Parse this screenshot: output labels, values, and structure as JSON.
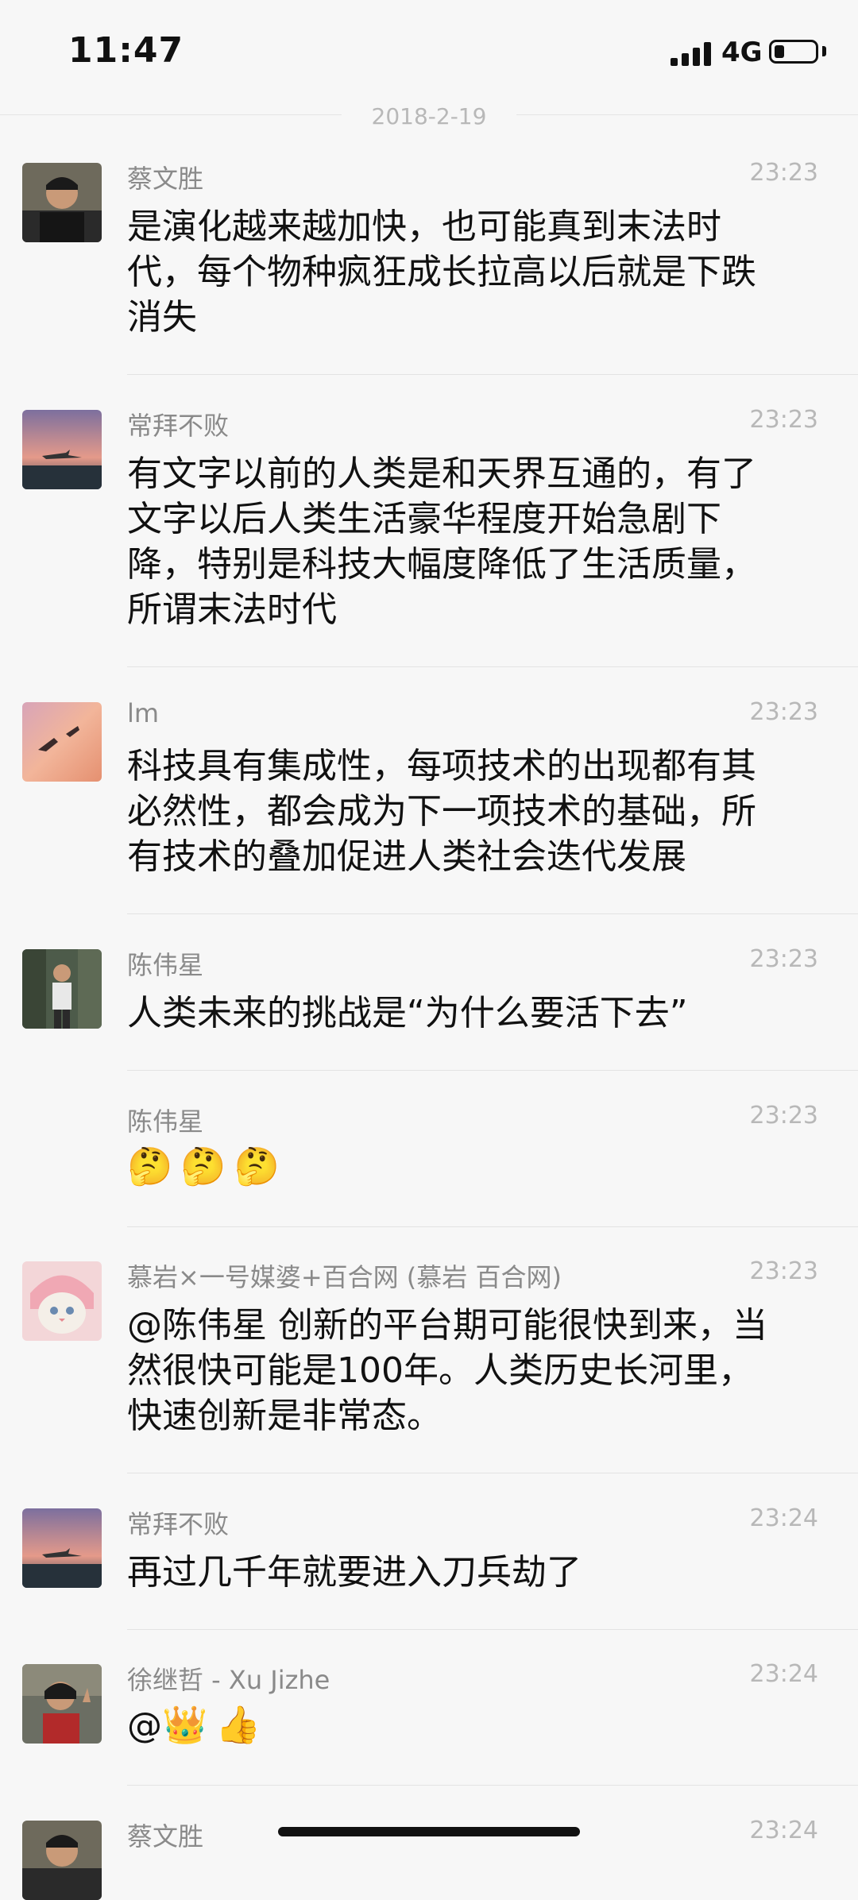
{
  "status_bar": {
    "time": "11:47",
    "network": "4G",
    "battery_level": 0.25
  },
  "date_separator": "2018-2-19",
  "messages": [
    {
      "sender": "蔡文胜",
      "time": "23:23",
      "text": [
        "是演化越来越加快，也可能真到末法时",
        "代，每个物种疯狂成长拉高以后就是下跌",
        "消失"
      ]
    },
    {
      "sender": "常拜不败",
      "time": "23:23",
      "text": [
        "有文字以前的人类是和天界互通的，有了",
        "文字以后人类生活豪华程度开始急剧下",
        "降，特别是科技大幅度降低了生活质量，",
        "所谓末法时代"
      ]
    },
    {
      "sender": "lm",
      "time": "23:23",
      "text": [
        "科技具有集成性，每项技术的出现都有其",
        "必然性，都会成为下一项技术的基础，所",
        "有技术的叠加促进人类社会迭代发展"
      ]
    },
    {
      "sender": "陈伟星",
      "time": "23:23",
      "text": [
        "人类未来的挑战是“为什么要活下去”"
      ]
    },
    {
      "sender": "陈伟星",
      "time": "23:23",
      "emoji": [
        "🤔",
        "🤔",
        "🤔"
      ]
    },
    {
      "sender": "慕岩×一号媒婆+百合网 (慕岩 百合网)",
      "time": "23:23",
      "text": [
        "@陈伟星 创新的平台期可能很快到来，当",
        "然很快可能是100年。人类历史长河里，",
        "快速创新是非常态。"
      ]
    },
    {
      "sender": "常拜不败",
      "time": "23:24",
      "text": [
        "再过几千年就要进入刀兵劫了"
      ]
    },
    {
      "sender": "徐继哲 - Xu Jizhe",
      "time": "23:24",
      "text_prefix": "@",
      "emoji": [
        "👑",
        "👍"
      ]
    },
    {
      "sender": "蔡文胜",
      "time": "23:24"
    }
  ]
}
